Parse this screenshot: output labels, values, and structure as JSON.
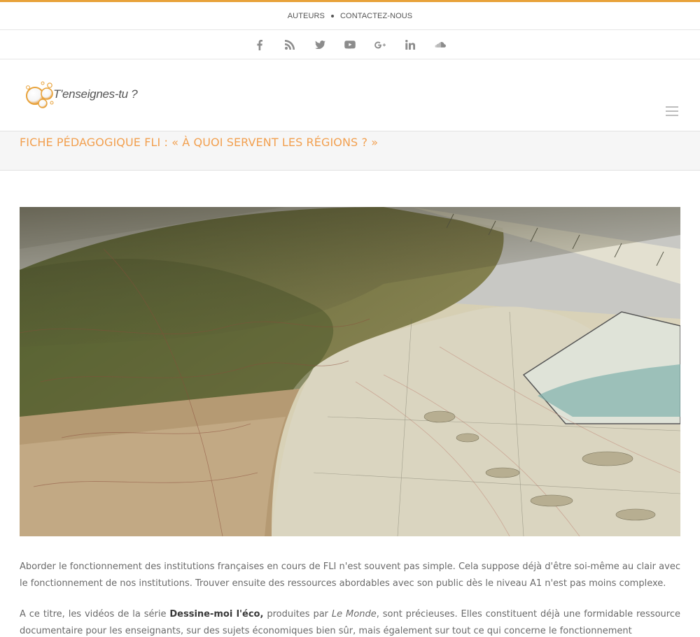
{
  "colors": {
    "accent": "#e8a23a",
    "title": "#f2a050",
    "text": "#6a6a6a"
  },
  "top_nav": {
    "items": [
      "AUTEURS",
      "CONTACTEZ-NOUS"
    ]
  },
  "social": [
    "facebook-icon",
    "rss-icon",
    "twitter-icon",
    "youtube-icon",
    "google-plus-icon",
    "linkedin-icon",
    "soundcloud-icon"
  ],
  "logo": {
    "text": "T'enseignes-tu ?"
  },
  "page": {
    "title": "FICHE PÉDAGOGIQUE FLI : « À QUOI SERVENT LES RÉGIONS ? »"
  },
  "hero": {
    "alt": "vintage map",
    "icon": "map-photo"
  },
  "article": {
    "p1": "Aborder le fonctionnement des institutions françaises en cours de FLI n'est souvent pas simple. Cela suppose déjà d'être soi-même au clair avec le fonctionnement de nos institutions. Trouver ensuite des ressources abordables avec son public dès le niveau A1 n'est pas moins complexe.",
    "p2_a": "A ce titre, les vidéos de la série ",
    "p2_bold": "Dessine-moi l'éco,",
    "p2_b": " produites par ",
    "p2_italic": "Le Monde",
    "p2_c": ", sont précieuses. Elles constituent déjà une formidable ressource documentaire pour les enseignants, sur des sujets économiques bien sûr, mais également sur tout ce qui concerne le fonctionnement"
  }
}
